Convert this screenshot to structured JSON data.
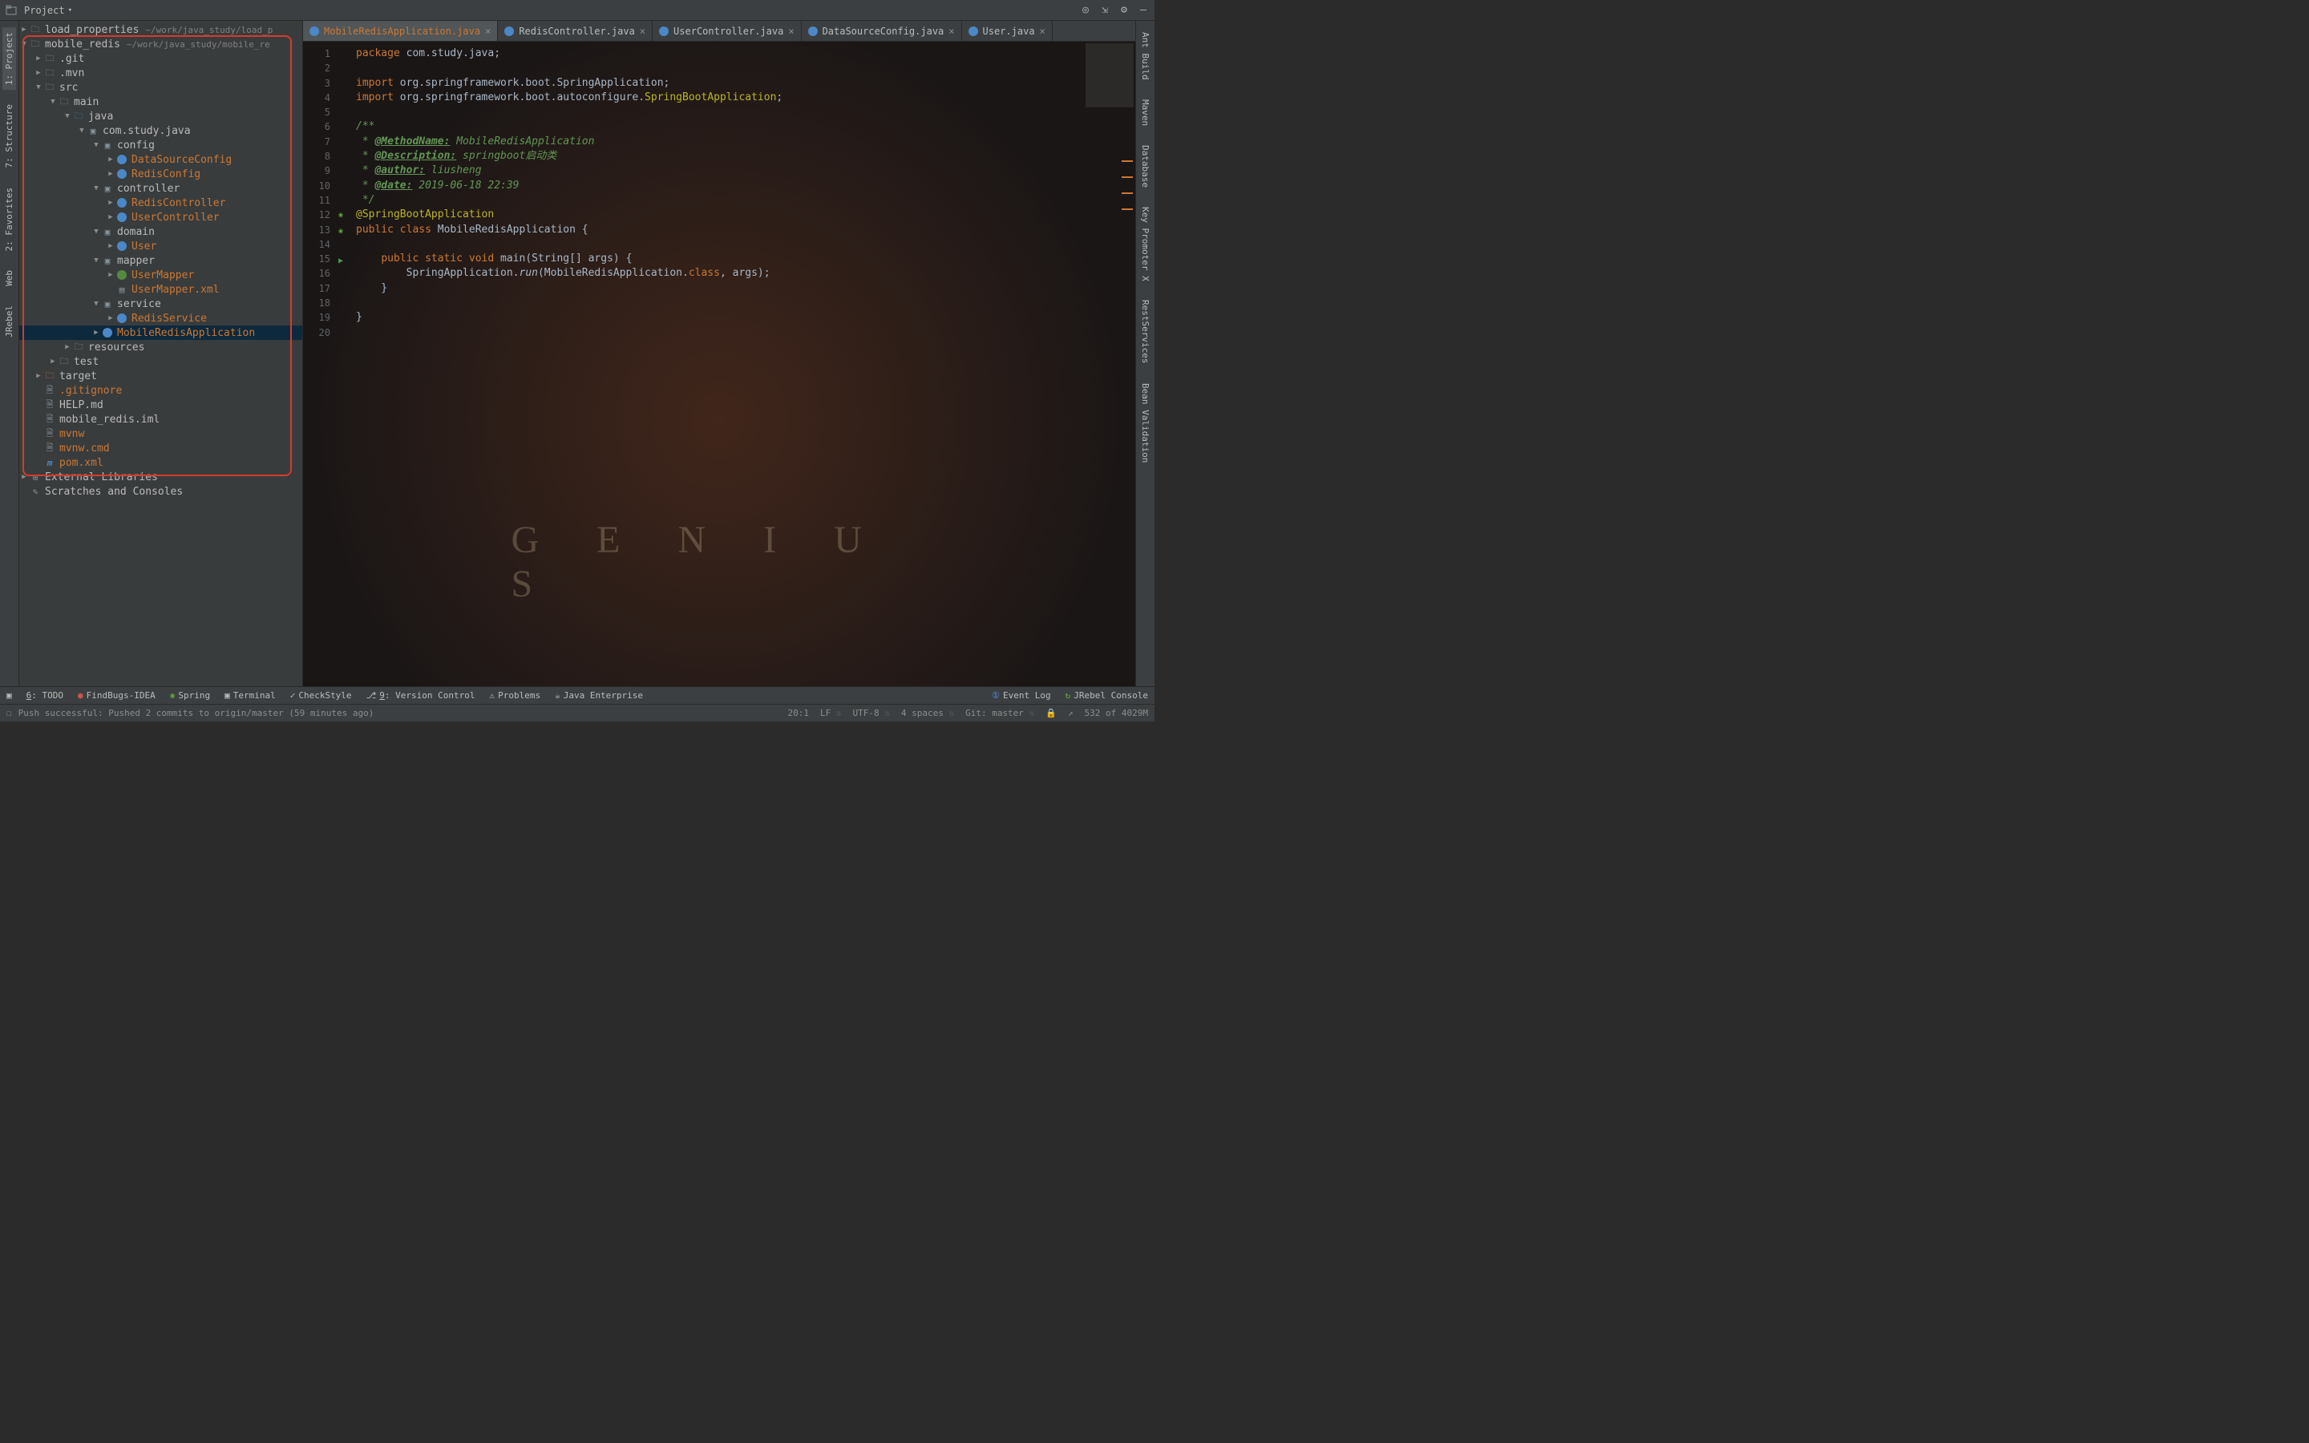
{
  "toolbar": {
    "project_label": "Project"
  },
  "tree": {
    "items": [
      {
        "depth": 0,
        "arrow": "▶",
        "icon": "folder",
        "label": "load_properties",
        "path": "~/work/java_study/load_p",
        "orange": false
      },
      {
        "depth": 0,
        "arrow": "▼",
        "icon": "folder",
        "label": "mobile_redis",
        "path": "~/work/java_study/mobile_re",
        "orange": false
      },
      {
        "depth": 1,
        "arrow": "▶",
        "icon": "folder",
        "label": ".git",
        "orange": false
      },
      {
        "depth": 1,
        "arrow": "▶",
        "icon": "folder",
        "label": ".mvn",
        "orange": false
      },
      {
        "depth": 1,
        "arrow": "▼",
        "icon": "folder",
        "label": "src",
        "orange": false
      },
      {
        "depth": 2,
        "arrow": "▼",
        "icon": "folder",
        "label": "main",
        "orange": false
      },
      {
        "depth": 3,
        "arrow": "▼",
        "icon": "folder-java",
        "label": "java",
        "orange": false
      },
      {
        "depth": 4,
        "arrow": "▼",
        "icon": "package",
        "label": "com.study.java",
        "orange": false
      },
      {
        "depth": 5,
        "arrow": "▼",
        "icon": "package",
        "label": "config",
        "orange": false
      },
      {
        "depth": 6,
        "arrow": "▶",
        "icon": "class",
        "label": "DataSourceConfig",
        "orange": true
      },
      {
        "depth": 6,
        "arrow": "▶",
        "icon": "class",
        "label": "RedisConfig",
        "orange": true
      },
      {
        "depth": 5,
        "arrow": "▼",
        "icon": "package",
        "label": "controller",
        "orange": false
      },
      {
        "depth": 6,
        "arrow": "▶",
        "icon": "class",
        "label": "RedisController",
        "orange": true
      },
      {
        "depth": 6,
        "arrow": "▶",
        "icon": "class",
        "label": "UserController",
        "orange": true
      },
      {
        "depth": 5,
        "arrow": "▼",
        "icon": "package",
        "label": "domain",
        "orange": false
      },
      {
        "depth": 6,
        "arrow": "▶",
        "icon": "class",
        "label": "User",
        "orange": true
      },
      {
        "depth": 5,
        "arrow": "▼",
        "icon": "package",
        "label": "mapper",
        "orange": false
      },
      {
        "depth": 6,
        "arrow": "▶",
        "icon": "interface",
        "label": "UserMapper",
        "orange": true
      },
      {
        "depth": 6,
        "arrow": "",
        "icon": "xml",
        "label": "UserMapper.xml",
        "orange": true
      },
      {
        "depth": 5,
        "arrow": "▼",
        "icon": "package",
        "label": "service",
        "orange": false
      },
      {
        "depth": 6,
        "arrow": "▶",
        "icon": "class",
        "label": "RedisService",
        "orange": true
      },
      {
        "depth": 5,
        "arrow": "▶",
        "icon": "class",
        "label": "MobileRedisApplication",
        "orange": true,
        "selected": true
      },
      {
        "depth": 3,
        "arrow": "▶",
        "icon": "folder-res",
        "label": "resources",
        "orange": false
      },
      {
        "depth": 2,
        "arrow": "▶",
        "icon": "folder",
        "label": "test",
        "orange": false
      },
      {
        "depth": 1,
        "arrow": "▶",
        "icon": "folder-target",
        "label": "target",
        "orange": false
      },
      {
        "depth": 1,
        "arrow": "",
        "icon": "file",
        "label": ".gitignore",
        "orange": true
      },
      {
        "depth": 1,
        "arrow": "",
        "icon": "file",
        "label": "HELP.md",
        "orange": false
      },
      {
        "depth": 1,
        "arrow": "",
        "icon": "file",
        "label": "mobile_redis.iml",
        "orange": false
      },
      {
        "depth": 1,
        "arrow": "",
        "icon": "file",
        "label": "mvnw",
        "orange": true
      },
      {
        "depth": 1,
        "arrow": "",
        "icon": "file",
        "label": "mvnw.cmd",
        "orange": true
      },
      {
        "depth": 1,
        "arrow": "",
        "icon": "file-m",
        "label": "pom.xml",
        "orange": true
      }
    ],
    "extra": [
      {
        "depth": 0,
        "arrow": "▶",
        "icon": "lib",
        "label": "External Libraries",
        "orange": false
      },
      {
        "depth": 0,
        "arrow": "",
        "icon": "scratch",
        "label": "Scratches and Consoles",
        "orange": false
      }
    ]
  },
  "tabs": [
    {
      "label": "MobileRedisApplication.java",
      "active": true,
      "orange": true
    },
    {
      "label": "RedisController.java",
      "active": false,
      "orange": false
    },
    {
      "label": "UserController.java",
      "active": false,
      "orange": false
    },
    {
      "label": "DataSourceConfig.java",
      "active": false,
      "orange": false
    },
    {
      "label": "User.java",
      "active": false,
      "orange": false
    }
  ],
  "code": {
    "lines": [
      {
        "n": 1,
        "html": "<span class='kw'>package</span> com.study.java;"
      },
      {
        "n": 2,
        "html": ""
      },
      {
        "n": 3,
        "html": "<span class='kw'>import</span> org.springframework.boot.SpringApplication;"
      },
      {
        "n": 4,
        "html": "<span class='kw'>import</span> org.springframework.boot.autoconfigure.<span class='ann'>SpringBootApplication</span>;"
      },
      {
        "n": 5,
        "html": ""
      },
      {
        "n": 6,
        "html": "<span class='doc'>/**</span>"
      },
      {
        "n": 7,
        "html": "<span class='doc'> * <span class='doctag'>@MethodName:</span> MobileRedisApplication</span>"
      },
      {
        "n": 8,
        "html": "<span class='doc'> * <span class='doctag'>@Description:</span> springboot启动类</span>"
      },
      {
        "n": 9,
        "html": "<span class='doc'> * <span class='doctag'>@author:</span> liusheng</span>"
      },
      {
        "n": 10,
        "html": "<span class='doc'> * <span class='doctag'>@date:</span> 2019-06-18 22:39</span>"
      },
      {
        "n": 11,
        "html": "<span class='doc'> */</span>"
      },
      {
        "n": 12,
        "html": "<span class='ann'>@SpringBootApplication</span>",
        "mark": "spring"
      },
      {
        "n": 13,
        "html": "<span class='kw'>public class</span> <span class='cls'>MobileRedisApplication</span> {",
        "mark": "spring"
      },
      {
        "n": 14,
        "html": ""
      },
      {
        "n": 15,
        "html": "    <span class='kw'>public static void</span> main(String[] args) {",
        "mark": "run"
      },
      {
        "n": 16,
        "html": "        SpringApplication.<span class='method-italic'>run</span>(MobileRedisApplication.<span class='kw'>class</span>, args);"
      },
      {
        "n": 17,
        "html": "    }"
      },
      {
        "n": 18,
        "html": ""
      },
      {
        "n": 19,
        "html": "}"
      },
      {
        "n": 20,
        "html": ""
      }
    ]
  },
  "bottom": {
    "items_left": [
      {
        "label": "6: TODO",
        "underline": "6"
      },
      {
        "label": "FindBugs-IDEA",
        "icon": "●",
        "color": "#c75450"
      },
      {
        "label": "Spring",
        "icon": "❀",
        "color": "#6db33f"
      },
      {
        "label": "Terminal",
        "icon": "▣"
      },
      {
        "label": "CheckStyle",
        "icon": "✓"
      },
      {
        "label": "9: Version Control",
        "underline": "9",
        "icon": "⎇"
      },
      {
        "label": "Problems",
        "icon": "⚠"
      },
      {
        "label": "Java Enterprise",
        "icon": "☕"
      }
    ],
    "items_right": [
      {
        "label": "Event Log",
        "icon": "①",
        "color": "#5394ec"
      },
      {
        "label": "JRebel Console",
        "icon": "↻",
        "color": "#6db33f"
      }
    ]
  },
  "status": {
    "message": "Push successful: Pushed 2 commits to origin/master (59 minutes ago)",
    "pos": "20:1",
    "lf": "LF",
    "enc": "UTF-8",
    "indent": "4 spaces",
    "git": "Git: master",
    "mem": "532 of 4029M"
  },
  "left_tabs": [
    "1: Project",
    "7: Structure",
    "2: Favorites",
    "Web",
    "JRebel"
  ],
  "right_tabs": [
    "Ant Build",
    "Maven",
    "Database",
    "Key Promoter X",
    "RestServices",
    "Bean Validation"
  ]
}
